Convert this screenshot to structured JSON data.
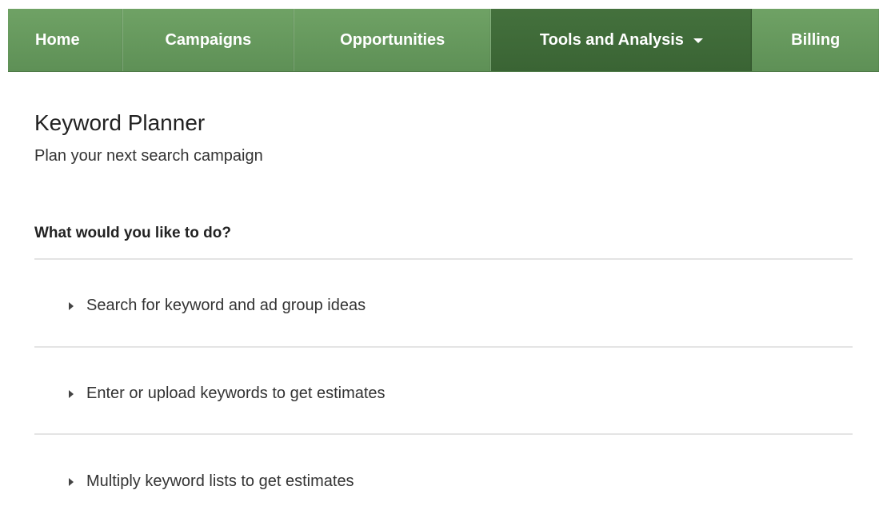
{
  "nav": {
    "tabs": [
      {
        "label": "Home"
      },
      {
        "label": "Campaigns"
      },
      {
        "label": "Opportunities"
      },
      {
        "label": "Tools and Analysis"
      },
      {
        "label": "Billing"
      }
    ],
    "active_tab": "Tools and Analysis",
    "color": "#5e9056",
    "active_color": "#3f6a39"
  },
  "header": {
    "title": "Keyword Planner",
    "subtitle": "Plan your next search campaign"
  },
  "main": {
    "question": "What would you like to do?",
    "options": [
      {
        "label": "Search for keyword and ad group ideas",
        "icon": "triangle-right-icon"
      },
      {
        "label": "Enter or upload keywords to get estimates",
        "icon": "triangle-right-icon"
      },
      {
        "label": "Multiply keyword lists to get estimates",
        "icon": "triangle-right-icon"
      }
    ]
  }
}
